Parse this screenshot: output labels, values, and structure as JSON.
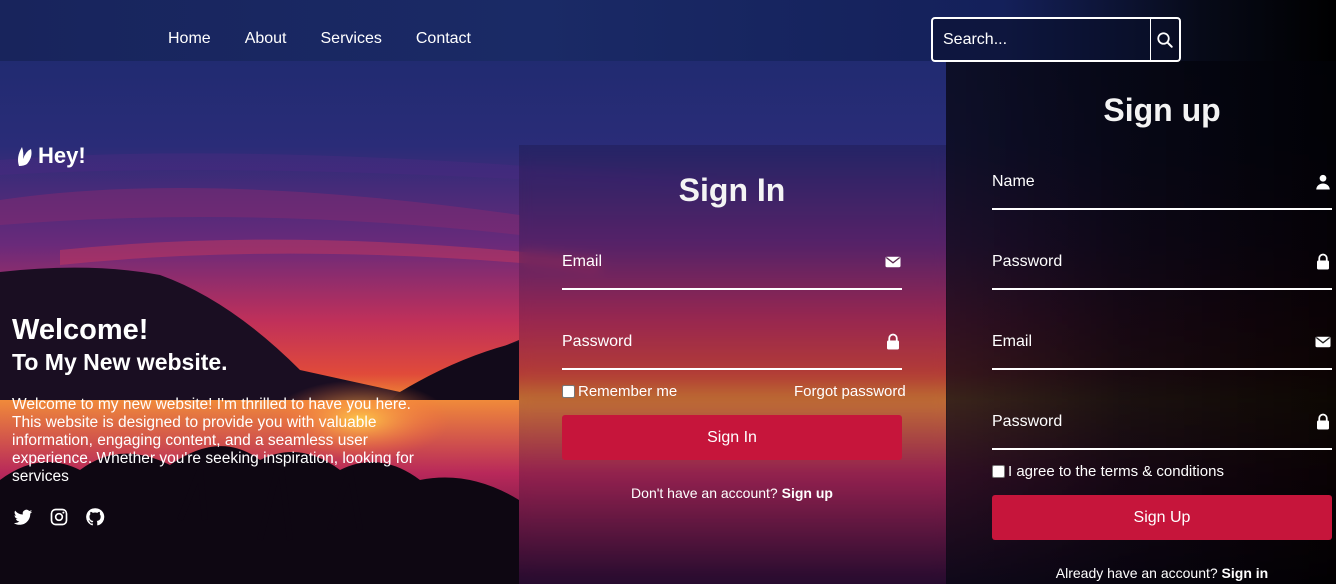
{
  "nav": {
    "items": [
      {
        "label": "Home"
      },
      {
        "label": "About"
      },
      {
        "label": "Services"
      },
      {
        "label": "Contact"
      }
    ]
  },
  "search": {
    "placeholder": "Search...",
    "icon": "search-icon"
  },
  "hero": {
    "greeting": "Hey!",
    "greeting_icon": "leaf-icon",
    "title": "Welcome!",
    "subtitle": "To My New website.",
    "description": "Welcome to my new website! I'm thrilled to have you here. This website is designed to provide you with valuable information, engaging content, and a seamless user experience. Whether you're seeking inspiration, looking for services",
    "socials": [
      "twitter-icon",
      "instagram-icon",
      "github-icon"
    ]
  },
  "signin": {
    "title": "Sign In",
    "email_label": "Email",
    "password_label": "Password",
    "remember_label": "Remember me",
    "forgot_label": "Forgot password",
    "button_label": "Sign In",
    "switch_text": "Don't have an account?",
    "switch_link": "Sign up"
  },
  "signup": {
    "title": "Sign up",
    "name_label": "Name",
    "password_label": "Password",
    "email_label": "Email",
    "password2_label": "Password",
    "terms_label": "I agree to the terms & conditions",
    "button_label": "Sign Up",
    "switch_text": "Already have an account?",
    "switch_link": "Sign in"
  },
  "colors": {
    "accent": "#c6153b",
    "header": "#1a2a66"
  }
}
